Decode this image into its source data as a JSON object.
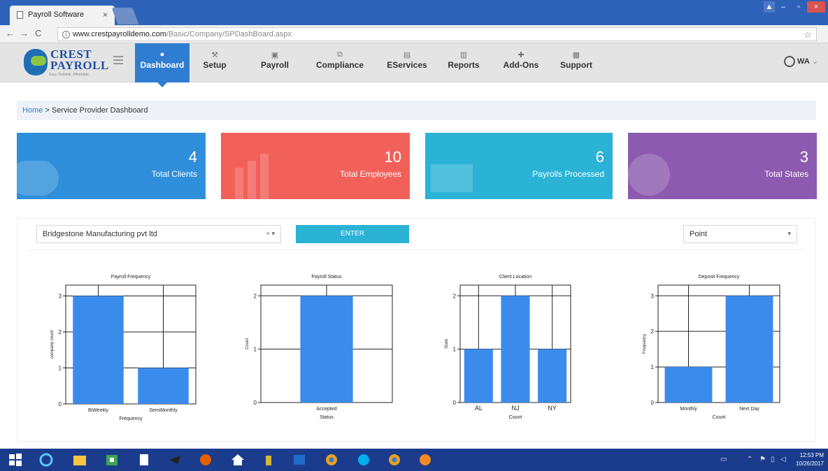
{
  "browser": {
    "tab_title": "Payroll Software",
    "tab_close": "×",
    "url_host": "www.crestpayrolldemo.com",
    "url_path": "/Basic/Company/SPDashBoard.aspx"
  },
  "app": {
    "logo_line1": "CREST",
    "logo_line2": "PAYROLL",
    "logo_tagline": "Easy. Reliable. Affordable.",
    "nav": [
      {
        "label": "Dashboard",
        "icon": "dashboard-icon"
      },
      {
        "label": "Setup",
        "icon": "wrench-icon"
      },
      {
        "label": "Payroll",
        "icon": "payroll-icon"
      },
      {
        "label": "Compliance",
        "icon": "compliance-icon"
      },
      {
        "label": "EServices",
        "icon": "document-icon"
      },
      {
        "label": "Reports",
        "icon": "bar-chart-icon"
      },
      {
        "label": "Add-Ons",
        "icon": "plus-icon"
      },
      {
        "label": "Support",
        "icon": "support-icon"
      }
    ],
    "user_initials": "WA"
  },
  "breadcrumb": {
    "home": "Home",
    "separator": " > ",
    "current": "Service Provider Dashboard"
  },
  "stats": [
    {
      "value": "4",
      "label": "Total Clients",
      "color": "#2f8fdb"
    },
    {
      "value": "10",
      "label": "Total Employees",
      "color": "#f2605a"
    },
    {
      "value": "6",
      "label": "Payrolls Processed",
      "color": "#2bb3d6"
    },
    {
      "value": "3",
      "label": "Total States",
      "color": "#8c5bb0"
    }
  ],
  "filters": {
    "company": "Bridgestone Manufacturing pvt ltd",
    "company_controls": "× ▾",
    "enter_label": "ENTER",
    "chart_type": "Point",
    "chart_type_caret": "▾"
  },
  "chart_data": [
    {
      "type": "bar",
      "title": "Payroll Frequency",
      "categories": [
        "BiWeekly",
        "SemiMonthly"
      ],
      "values": [
        3,
        1
      ],
      "xlabel": "Frequency",
      "ylabel": "company count",
      "ylim": [
        0,
        3.3
      ],
      "yticks": [
        0,
        1,
        2,
        3
      ],
      "color": "#3b8beb"
    },
    {
      "type": "bar",
      "title": "Payroll Status",
      "categories": [
        "Accepted"
      ],
      "values": [
        2
      ],
      "xlabel": "Status",
      "ylabel": "Count",
      "ylim": [
        0,
        2.2
      ],
      "yticks": [
        0,
        1,
        2
      ],
      "color": "#3b8beb"
    },
    {
      "type": "bar",
      "title": "Client Location",
      "categories": [
        "AL",
        "NJ",
        "NY"
      ],
      "values": [
        1,
        2,
        1
      ],
      "xlabel": "Count",
      "ylabel": "State",
      "ylim": [
        0,
        2.2
      ],
      "yticks": [
        0,
        1,
        2
      ],
      "color": "#3b8beb"
    },
    {
      "type": "bar",
      "title": "Deposit Frequency",
      "categories": [
        "Monthly",
        "Next Day"
      ],
      "values": [
        1,
        3
      ],
      "xlabel": "Count",
      "ylabel": "Frequency",
      "ylim": [
        0,
        3.3
      ],
      "yticks": [
        0,
        1,
        2,
        3
      ],
      "color": "#3b8beb"
    }
  ],
  "taskbar": {
    "time": "12:53 PM",
    "date": "10/26/2017"
  }
}
